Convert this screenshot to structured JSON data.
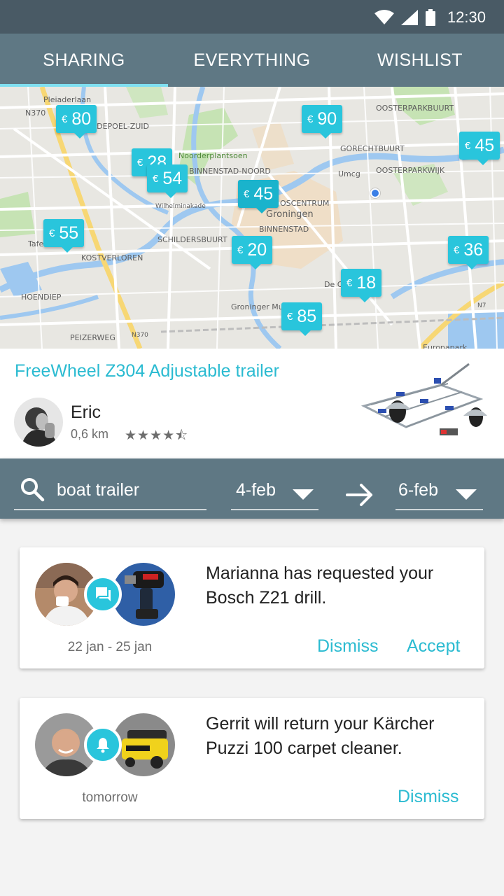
{
  "status": {
    "time": "12:30",
    "wifi_icon": "wifi-icon",
    "signal_icon": "signal-icon",
    "battery_icon": "battery-icon"
  },
  "tabs": [
    {
      "label": "SHARING",
      "active": true
    },
    {
      "label": "EVERYTHING",
      "active": false
    },
    {
      "label": "WISHLIST",
      "active": false
    }
  ],
  "map": {
    "currency": "€",
    "pins": [
      {
        "value": "80"
      },
      {
        "value": "90"
      },
      {
        "value": "45"
      },
      {
        "value": "28"
      },
      {
        "value": "54"
      },
      {
        "value": "45"
      },
      {
        "value": "55"
      },
      {
        "value": "20"
      },
      {
        "value": "36"
      },
      {
        "value": "18"
      },
      {
        "value": "85"
      }
    ],
    "labels": {
      "l1": "N370",
      "l2": "Pleiaderlaan",
      "l3": "LDEPOEL-ZUID",
      "l4": "OOSTERPARKBUURT",
      "l5": "Noorderplantsoen",
      "l6": "BINNENSTAD-NOORD",
      "l7": "GORECHTBUURT",
      "l8": "OOSTERPARKWIJK",
      "l9": "Umcg",
      "l10": "Groningen",
      "l11": "BINNENSTAD",
      "l12": "SCHILDERSBUURT",
      "l13": "KOSTVERLOREN",
      "l14": "HOENDIEP",
      "l15": "Groninger Museum",
      "l16": "De Oos",
      "l17": "PEIZERWEG",
      "l18": "N370",
      "l19": "Tafel",
      "l20": "Wilhelminakade",
      "l21": "N7",
      "l22": "OSCENTRUM",
      "l23": "Europapark"
    }
  },
  "listing": {
    "title": "FreeWheel Z304 Adjustable trailer",
    "owner": "Eric",
    "distance": "0,6 km",
    "rating": 4.5,
    "stars": "★★★★⯪"
  },
  "search": {
    "query": "boat trailer",
    "from_date": "4-feb",
    "to_date": "6-feb"
  },
  "cards": [
    {
      "message": "Marianna has requested your Bosch Z21 drill.",
      "date": "22 jan - 25 jan",
      "dismiss": "Dismiss",
      "accept": "Accept",
      "badge_icon": "chat-icon"
    },
    {
      "message": "Gerrit will return your Kärcher Puzzi 100 carpet cleaner.",
      "date": "tomorrow",
      "dismiss": "Dismiss",
      "badge_icon": "bell-icon"
    }
  ],
  "colors": {
    "accent": "#29c5dc",
    "header": "#5f7884",
    "statusbar": "#495a65"
  }
}
